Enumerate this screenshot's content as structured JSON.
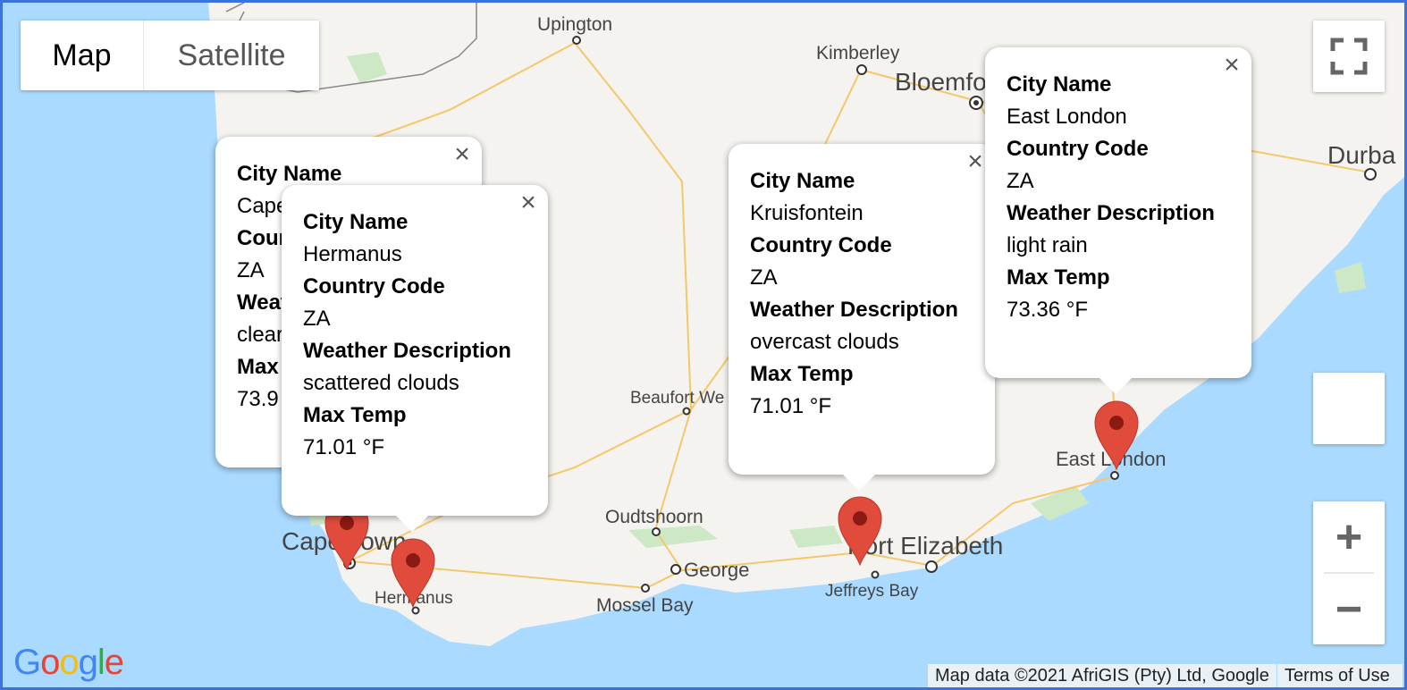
{
  "map_type": {
    "map_label": "Map",
    "satellite_label": "Satellite"
  },
  "places": {
    "upington": "Upington",
    "kimberley": "Kimberley",
    "bloemfontein": "Bloemfo",
    "durban": "Durba",
    "beaufort_west": "Beaufort We",
    "oudtshoorn": "Oudtshoorn",
    "george": "George",
    "mossel_bay": "Mossel Bay",
    "cape_town": "Cape Town",
    "hermanus": "Hermanus",
    "port_elizabeth": "Port Elizabeth",
    "jeffreys_bay": "Jeffreys Bay",
    "east_london": "East London"
  },
  "popups": [
    {
      "city_label": "City Name",
      "city": "Cape Town",
      "country_label": "Country Code",
      "country": "ZA",
      "weather_label": "Weather Description",
      "weather": "clear sky",
      "temp_label": "Max Temp",
      "temp": "73.9"
    },
    {
      "city_label": "City Name",
      "city": "Hermanus",
      "country_label": "Country Code",
      "country": "ZA",
      "weather_label": "Weather Description",
      "weather": "scattered clouds",
      "temp_label": "Max Temp",
      "temp": "71.01 °F"
    },
    {
      "city_label": "City Name",
      "city": "Kruisfontein",
      "country_label": "Country Code",
      "country": "ZA",
      "weather_label": "Weather Description",
      "weather": "overcast clouds",
      "temp_label": "Max Temp",
      "temp": "71.01 °F"
    },
    {
      "city_label": "City Name",
      "city": "East London",
      "country_label": "Country Code",
      "country": "ZA",
      "weather_label": "Weather Description",
      "weather": "light rain",
      "temp_label": "Max Temp",
      "temp": "73.36 °F"
    }
  ],
  "close_glyph": "×",
  "controls": {
    "zoom_in": "+",
    "zoom_out": "−"
  },
  "attribution": {
    "map_data": "Map data ©2021 AfriGIS (Pty) Ltd, Google",
    "terms": "Terms of Use"
  },
  "logo": {
    "letters": [
      "G",
      "o",
      "o",
      "g",
      "l",
      "e"
    ]
  },
  "colors": {
    "water": "#aadaff",
    "land": "#f5f3ef",
    "marker": "#e04b3c",
    "marker_dot": "#8b1a12",
    "road": "#f4c86a",
    "park": "#cde8c5"
  },
  "icons": {
    "fullscreen": "fullscreen-icon",
    "marker": "map-pin-icon",
    "close": "close-icon"
  }
}
